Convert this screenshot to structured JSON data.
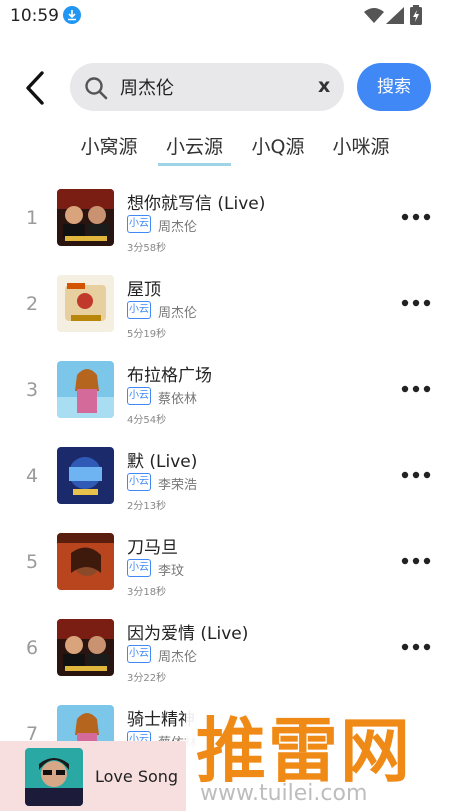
{
  "status_bar": {
    "time": "10:59"
  },
  "search": {
    "query": "周杰伦",
    "clear_label": "x",
    "button_label": "搜索"
  },
  "tabs": [
    {
      "label": "小窝源",
      "active": false
    },
    {
      "label": "小云源",
      "active": true
    },
    {
      "label": "小Q源",
      "active": false
    },
    {
      "label": "小咪源",
      "active": false
    }
  ],
  "songs": [
    {
      "index": "1",
      "title": "想你就写信 (Live)",
      "source": "小云",
      "artist": "周杰伦",
      "duration": "3分58秒"
    },
    {
      "index": "2",
      "title": "屋顶",
      "source": "小云",
      "artist": "周杰伦",
      "duration": "5分19秒"
    },
    {
      "index": "3",
      "title": "布拉格广场",
      "source": "小云",
      "artist": "蔡依林",
      "duration": "4分54秒"
    },
    {
      "index": "4",
      "title": "默 (Live)",
      "source": "小云",
      "artist": "李荣浩",
      "duration": "2分13秒"
    },
    {
      "index": "5",
      "title": "刀马旦",
      "source": "小云",
      "artist": "李玟",
      "duration": "3分18秒"
    },
    {
      "index": "6",
      "title": "因为爱情 (Live)",
      "source": "小云",
      "artist": "周杰伦",
      "duration": "3分22秒"
    },
    {
      "index": "7",
      "title": "骑士精神",
      "source": "小云",
      "artist": "蔡依林",
      "duration": ""
    }
  ],
  "player": {
    "title": "Love Song"
  },
  "watermark": {
    "logo_text": "推雷网",
    "url": "www.tuilei.com"
  },
  "colors": {
    "accent": "#3f88f5",
    "tab_underline": "#9fd3e6",
    "player_bg": "#f7dfe0",
    "watermark": "#f08a17"
  }
}
